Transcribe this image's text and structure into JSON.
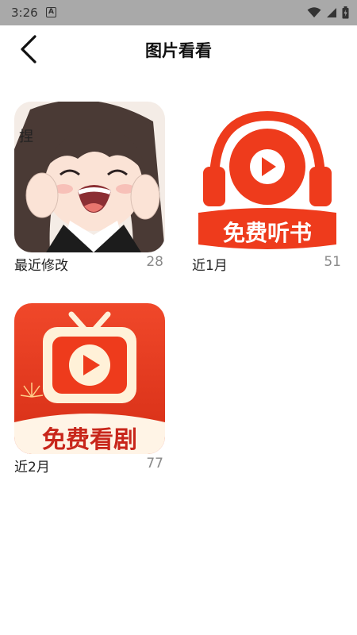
{
  "status_bar": {
    "time": "3:26",
    "notification_icon": "A",
    "icons": [
      "wifi-icon",
      "signal-icon",
      "battery-icon"
    ]
  },
  "header": {
    "title": "图片看看",
    "back_icon": "chevron-left-icon"
  },
  "albums": [
    {
      "name": "最近修改",
      "count": "28",
      "thumb": "anime-girl-image"
    },
    {
      "name": "近1月",
      "count": "51",
      "thumb": "audiobook-logo",
      "thumb_text": "免费听书"
    },
    {
      "name": "近2月",
      "count": "77",
      "thumb": "drama-tv-logo",
      "thumb_text": "免费看剧"
    }
  ],
  "colors": {
    "status_bar": "#a9a9a9",
    "brand_red": "#ee3b1c",
    "count_gray": "#8a8a8a"
  }
}
